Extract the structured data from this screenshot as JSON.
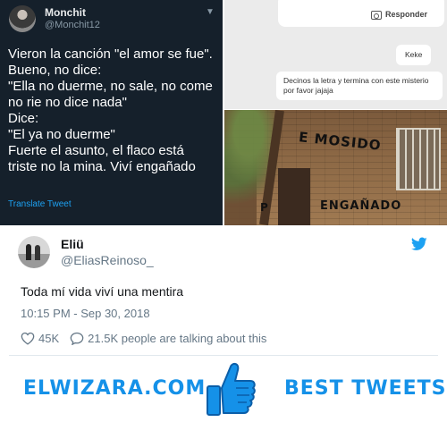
{
  "dark_tweet": {
    "name": "Monchit",
    "handle": "@Monchit12",
    "lines": [
      "Vieron la canción \"el amor se fue\".",
      "Bueno, no dice:",
      "\"Ella no duerme, no sale, no come",
      "no rie no dice nada\"",
      "Dice:",
      "\"El ya no duerme\"",
      "Fuerte el asunto, el flaco está",
      "triste no la mina. Viví engañado"
    ],
    "translate": "Translate Tweet"
  },
  "chat": {
    "reply_label": "Responder",
    "bubble_1": "Keke",
    "bubble_2": "Decinos la letra y termina con este misterio por favor jajaja"
  },
  "photo": {
    "graffiti_top": "E MOSIDO",
    "graffiti_bottom": "ENGAÑADO",
    "graffiti_left": "P"
  },
  "tweet": {
    "name": "Eliü",
    "handle": "@EliasReinoso_",
    "text": "Toda mí vida viví una mentira",
    "timestamp": "10:15 PM - Sep 30, 2018",
    "likes": "45K",
    "talking": "21.5K people are talking about this"
  },
  "footer": {
    "site": "ELWIZARA.COM",
    "tagline": "BEST TWEETS",
    "accent": "#1591e8"
  },
  "colors": {
    "twitter_blue": "#1da1f2",
    "dark_bg": "#15202b",
    "muted": "#657786"
  }
}
